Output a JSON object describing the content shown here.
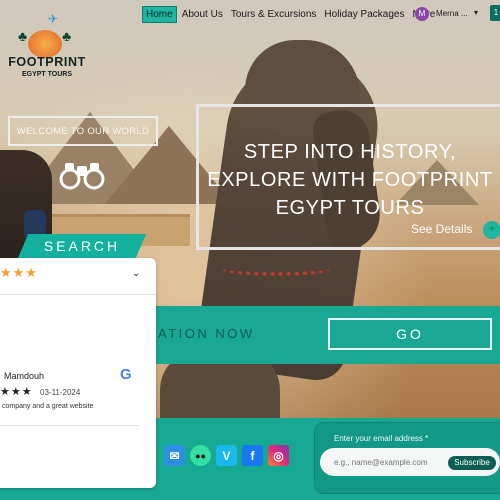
{
  "header": {
    "nav": [
      {
        "label": "Home",
        "active": true
      },
      {
        "label": "About Us",
        "active": false
      },
      {
        "label": "Tours & Excursions",
        "active": false
      },
      {
        "label": "Holiday Packages",
        "active": false
      },
      {
        "label": "More",
        "active": false
      }
    ],
    "avatar_initial": "M",
    "user_name": "Merna ...",
    "user_caret": "▾",
    "cart_count": "1"
  },
  "logo": {
    "title": "FOOTPRINT",
    "subtitle": "EGYPT TOURS"
  },
  "hero": {
    "welcome": "WELCOME TO OUR WORLD",
    "headline": "STEP INTO HISTORY, EXPLORE WITH FOOTPRINT EGYPT TOURS",
    "see_details": "See Details",
    "see_details_icon": "+"
  },
  "search": {
    "tab_label": "SEARCH",
    "destination_text": "ATION NOW",
    "go_label": "GO"
  },
  "review": {
    "stars": "★★★",
    "caret": "⌄",
    "name": "Mamdouh",
    "rating_stars": "★★★",
    "date": "03-11-2024",
    "text": "company and a great website",
    "google_logo": "G"
  },
  "social": {
    "icons": [
      "mail-icon",
      "tripadvisor-icon",
      "vimeo-icon",
      "facebook-icon",
      "instagram-icon"
    ],
    "glyphs": [
      "✉",
      "●●",
      "V",
      "f",
      "◎"
    ]
  },
  "newsletter": {
    "label": "Enter your email address *",
    "placeholder": "e.g., name@example.com",
    "button": "Subscribe"
  },
  "colors": {
    "teal": "#1aa894",
    "star": "#f2a12c"
  }
}
